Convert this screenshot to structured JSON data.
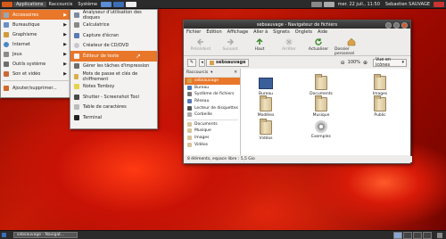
{
  "topbar": {
    "menus": [
      "Applications",
      "Raccourcis",
      "Système"
    ],
    "clock": "mer. 22 juil., 11:50",
    "user": "Sebastien SAUVAGE"
  },
  "apps_menu": {
    "items": [
      {
        "label": "Accessoires",
        "icon": "accessories-icon",
        "selected": true
      },
      {
        "label": "Bureautique",
        "icon": "office-icon"
      },
      {
        "label": "Graphisme",
        "icon": "graphics-icon"
      },
      {
        "label": "Internet",
        "icon": "internet-icon"
      },
      {
        "label": "Jeux",
        "icon": "games-icon"
      },
      {
        "label": "Outils système",
        "icon": "system-tools-icon"
      },
      {
        "label": "Son et vidéo",
        "icon": "multimedia-icon"
      }
    ],
    "footer": "Ajouter/supprimer..."
  },
  "accessories_menu": {
    "items": [
      "Analyseur d'utilisation des disques",
      "Calculatrice",
      "Capture d'écran",
      "Créateur de CD/DVD",
      "Éditeur de texte",
      "Gérer les tâches d'impression",
      "Mots de passe et clés de chiffrement",
      "Notes Tomboy",
      "Shutter - Screenshot Tool",
      "Table de caractères",
      "Terminal"
    ],
    "selected_index": 4
  },
  "window": {
    "title": "sebsauvage - Navigateur de fichiers",
    "menubar": [
      "Fichier",
      "Édition",
      "Affichage",
      "Aller à",
      "Signets",
      "Onglets",
      "Aide"
    ],
    "toolbar": [
      {
        "label": "Précédent",
        "enabled": false
      },
      {
        "label": "Suivant",
        "enabled": false
      },
      {
        "label": "Haut",
        "enabled": true
      },
      {
        "label": "Arrêter",
        "enabled": false
      },
      {
        "label": "Actualiser",
        "enabled": true
      },
      {
        "label": "Dossier personnel",
        "enabled": true
      }
    ],
    "location": "sebsauvage",
    "zoom": "100%",
    "view_mode": "Vue en icônes",
    "sidebar": {
      "header": "Raccourcis",
      "items": [
        "sebsauvage",
        "Bureau",
        "Système de fichiers",
        "Réseau",
        "Lecteur de disquettes",
        "Corbeille",
        "Documents",
        "Musique",
        "Images",
        "Vidéos"
      ],
      "selected_index": 0
    },
    "files": [
      "Bureau",
      "Documents",
      "Images",
      "Modèles",
      "Musique",
      "Public",
      "Vidéos",
      "Exemples"
    ],
    "status": "8 éléments, espace libre : 5,5 Gio"
  },
  "taskbar": {
    "item": "sebsauvage - Navigat..."
  }
}
